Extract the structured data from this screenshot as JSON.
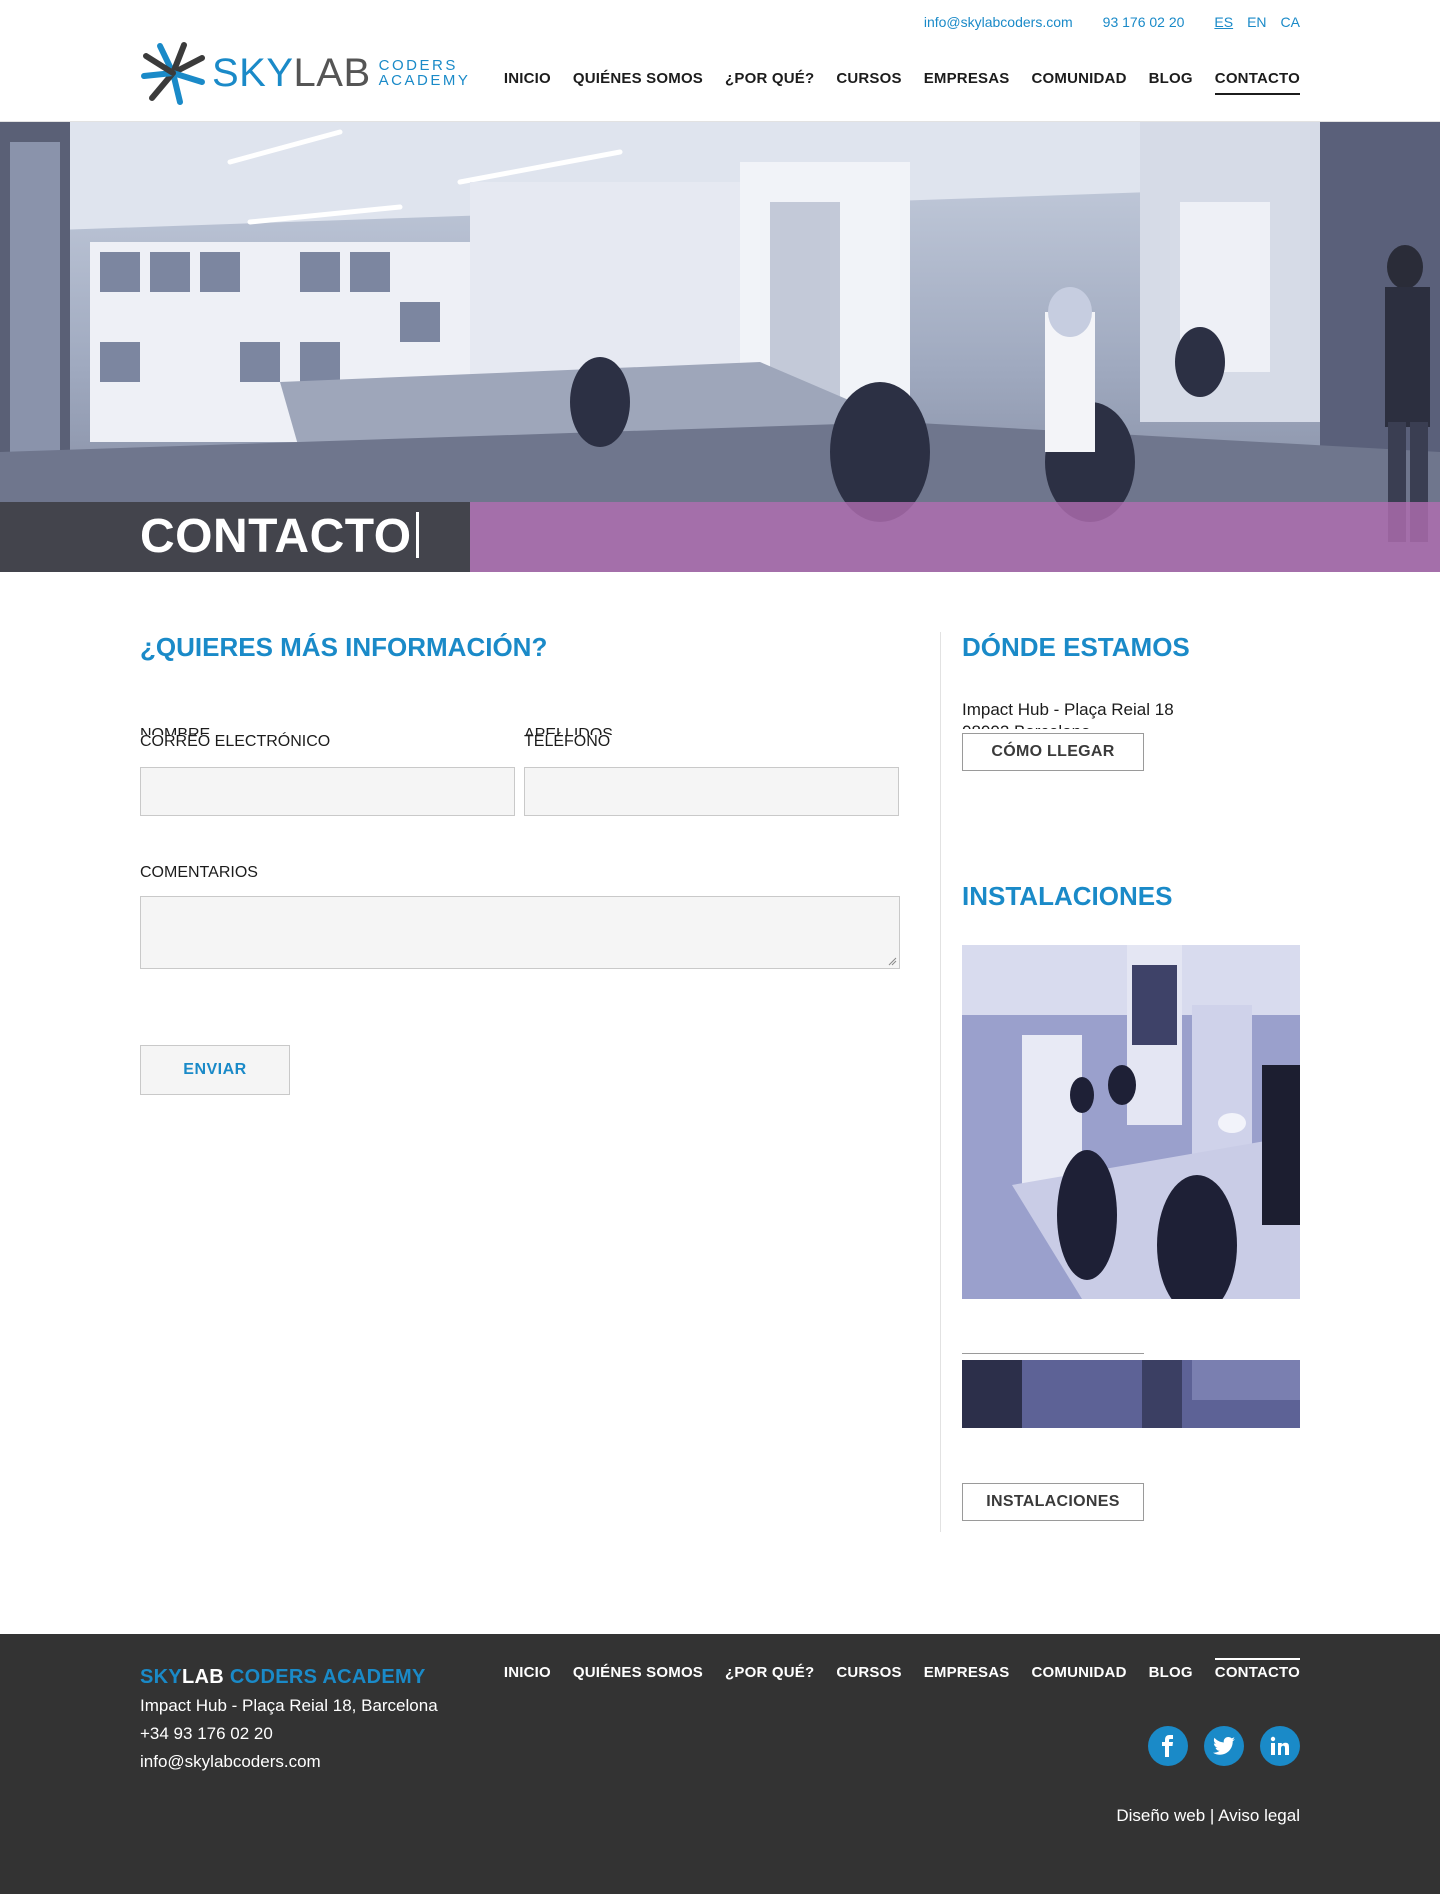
{
  "header": {
    "email": "info@skylabcoders.com",
    "phone": "93 176 02 20",
    "languages": [
      {
        "code": "ES",
        "active": true
      },
      {
        "code": "EN",
        "active": false
      },
      {
        "code": "CA",
        "active": false
      }
    ],
    "logo": {
      "sky": "SKY",
      "lab": "LAB",
      "sub_line1": "CODERS",
      "sub_line2": "ACADEMY",
      "icon": "asterisk-logo-icon"
    },
    "nav": [
      {
        "label": "INICIO",
        "active": false
      },
      {
        "label": "QUIÉNES SOMOS",
        "active": false
      },
      {
        "label": "¿POR QUÉ?",
        "active": false
      },
      {
        "label": "CURSOS",
        "active": false
      },
      {
        "label": "EMPRESAS",
        "active": false
      },
      {
        "label": "COMUNIDAD",
        "active": false
      },
      {
        "label": "BLOG",
        "active": false
      },
      {
        "label": "CONTACTO",
        "active": true
      }
    ]
  },
  "hero": {
    "title": "CONTACTO"
  },
  "form": {
    "title": "¿QUIERES MÁS INFORMACIÓN?",
    "labels": {
      "nombre": "NOMBRE",
      "apellidos": "APELLIDOS",
      "email": "CORREO ELECTRÓNICO",
      "telefono": "TELÉFONO",
      "comentarios": "COMENTARIOS"
    },
    "submit": "ENVIAR"
  },
  "sidebar": {
    "where_title": "DÓNDE ESTAMOS",
    "address": "Impact Hub - Plaça Reial 18",
    "address_line2": "08002 Barcelona",
    "directions_button": "CÓMO LLEGAR",
    "facilities_title": "INSTALACIONES",
    "facilities_button": "INSTALACIONES"
  },
  "footer": {
    "brand_sky": "SKY",
    "brand_lab": "LAB",
    "brand_rest": " CODERS ACADEMY",
    "address": "Impact Hub - Plaça Reial 18, Barcelona",
    "phone": "+34 93 176 02 20",
    "email": "info@skylabcoders.com",
    "nav": [
      {
        "label": "INICIO",
        "active": false
      },
      {
        "label": "QUIÉNES SOMOS",
        "active": false
      },
      {
        "label": "¿POR QUÉ?",
        "active": false
      },
      {
        "label": "CURSOS",
        "active": false
      },
      {
        "label": "EMPRESAS",
        "active": false
      },
      {
        "label": "COMUNIDAD",
        "active": false
      },
      {
        "label": "BLOG",
        "active": false
      },
      {
        "label": "CONTACTO",
        "active": true
      }
    ],
    "socials": [
      {
        "icon": "facebook-icon",
        "glyph": "f"
      },
      {
        "icon": "twitter-icon",
        "glyph": "t"
      },
      {
        "icon": "linkedin-icon",
        "glyph": "in"
      }
    ],
    "legal_design": "Diseño web",
    "legal_separator": " | ",
    "legal_notice": "Aviso legal"
  },
  "colors": {
    "accent": "#1a8ac8",
    "dark": "#333333",
    "hero_band_left": "#3c3c41",
    "hero_band_right": "#b26eb2",
    "field_bg": "#f5f5f5"
  }
}
